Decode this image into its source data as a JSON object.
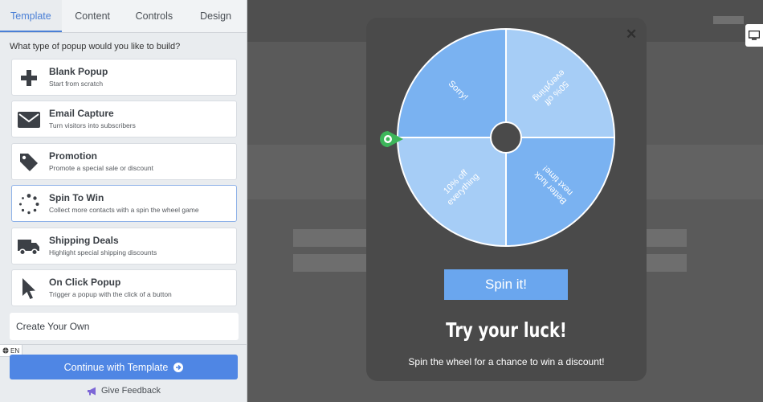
{
  "tabs": [
    {
      "label": "Template",
      "active": true
    },
    {
      "label": "Content",
      "active": false
    },
    {
      "label": "Controls",
      "active": false
    },
    {
      "label": "Design",
      "active": false
    }
  ],
  "question": "What type of popup would you like to build?",
  "templates": [
    {
      "title": "Blank Popup",
      "subtitle": "Start from scratch",
      "icon": "plus-icon"
    },
    {
      "title": "Email Capture",
      "subtitle": "Turn visitors into subscribers",
      "icon": "envelope-icon"
    },
    {
      "title": "Promotion",
      "subtitle": "Promote a special sale or discount",
      "icon": "tag-icon"
    },
    {
      "title": "Spin To Win",
      "subtitle": "Collect more contacts with a spin the wheel game",
      "icon": "spinner-icon",
      "selected": true
    },
    {
      "title": "Shipping Deals",
      "subtitle": "Highlight special shipping discounts",
      "icon": "truck-icon"
    },
    {
      "title": "On Click Popup",
      "subtitle": "Trigger a popup with the click of a button",
      "icon": "cursor-icon"
    }
  ],
  "create_own": "Create Your Own",
  "language": "EN",
  "continue_label": "Continue with Template",
  "feedback_label": "Give Feedback",
  "popup": {
    "wheel_segments": [
      "Sorry!",
      "50% off everything",
      "Better luck next time!",
      "10% off everything"
    ],
    "spin_label": "Spin it!",
    "headline": "Try your luck!",
    "subline": "Spin the wheel for a chance to win a discount!"
  },
  "colors": {
    "accent": "#4f86e4",
    "wheel_dark": "#7ab2f1",
    "wheel_light": "#a6cdf6",
    "pointer": "#3db55a",
    "modal_bg": "#4a4a4a"
  }
}
